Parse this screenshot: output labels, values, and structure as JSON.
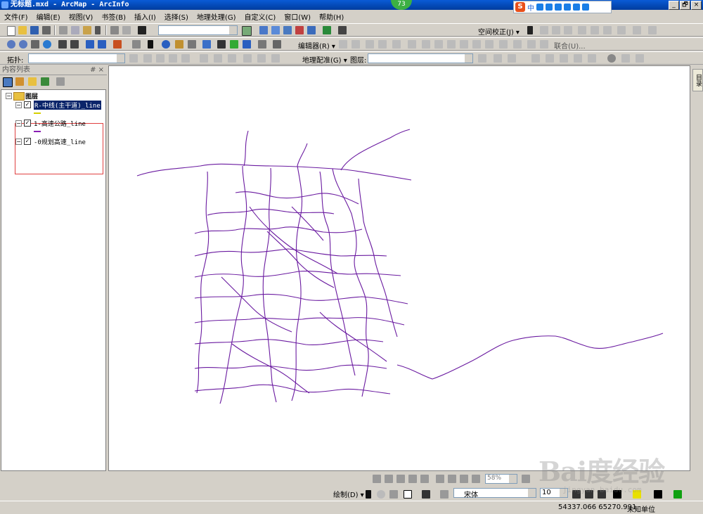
{
  "window": {
    "title": "无标题.mxd - ArcMap - ArcInfo",
    "notification_count": "73",
    "controls": [
      "_",
      "🗗",
      "×"
    ]
  },
  "ime": {
    "logo": "S",
    "mode": "中"
  },
  "menubar": {
    "items": [
      "文件(F)",
      "编辑(E)",
      "视图(V)",
      "书签(B)",
      "插入(I)",
      "选择(S)",
      "地理处理(G)",
      "自定义(C)",
      "窗口(W)",
      "帮助(H)"
    ]
  },
  "toolbars": {
    "spatial_adjust_label": "空间校正(J) ▾",
    "editor_label": "编辑器(R) ▾",
    "topology_label": "拓扑:",
    "georef_label": "地理配准(G) ▾",
    "layer_label": "图层:",
    "merge_label": "联合(U)..."
  },
  "toc": {
    "title": "内容列表",
    "pin": "# ×",
    "root": "图层",
    "layers": [
      {
        "name": "R-中线(主干道)_line",
        "color": "#d6d000",
        "selected": true
      },
      {
        "name": "1-高速公路_line",
        "color": "#8a1eb4",
        "selected": false
      },
      {
        "name": "-0规划高速_line",
        "color": "#8a1eb4",
        "selected": false
      }
    ]
  },
  "map": {
    "line_color": "#6a1aa0",
    "accent": "#6a1aa0"
  },
  "right_panel": {
    "tab_label": "目录"
  },
  "bottom": {
    "zoom_value": "58%",
    "draw_label": "绘制(D) ▾",
    "font_name": "宋体",
    "font_size": "10"
  },
  "status": {
    "coords": "54337.066  65270.991",
    "unit": "未知单位"
  },
  "watermark": {
    "brand": "Bai度经验",
    "url": "jingyan.baidu.com"
  }
}
